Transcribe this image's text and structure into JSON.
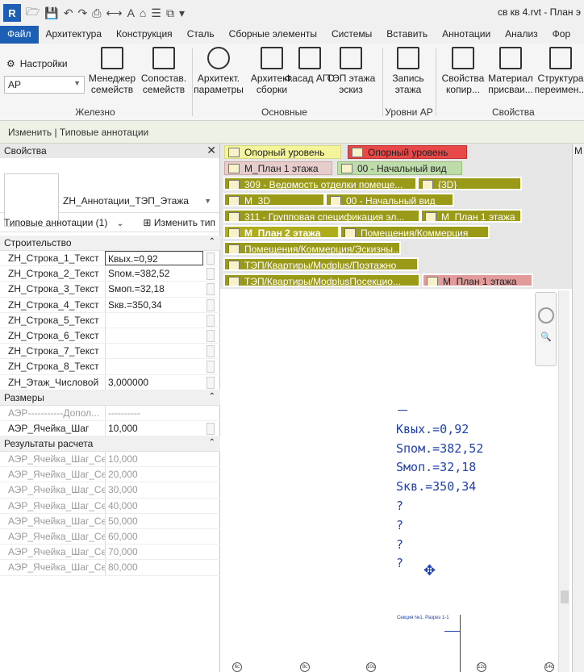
{
  "qat": {
    "logo": "R",
    "window_title": "св кв 4.rvt - План э"
  },
  "tabs": [
    "Файл",
    "Архитектура",
    "Конструкция",
    "Сталь",
    "Сборные элементы",
    "Системы",
    "Вставить",
    "Аннотации",
    "Анализ",
    "Фор"
  ],
  "ribbon": {
    "settings_label": "Настройки",
    "dropdown_value": "AP",
    "buttons": [
      {
        "label": "Менеджер семейств"
      },
      {
        "label": "Сопостав. семейств"
      },
      {
        "label": "Архитект. параметры"
      },
      {
        "label": "Архитект. сборки"
      },
      {
        "label": "Фасад АГО"
      },
      {
        "label": "ТЭП этажа эскиз"
      },
      {
        "label": "Запись этажа"
      },
      {
        "label": "Свойства копир..."
      },
      {
        "label": "Материал присваи..."
      },
      {
        "label": "Структура переимен..."
      }
    ],
    "groups": [
      "Железно",
      "Основные",
      "Уровни АР",
      "Свойства"
    ]
  },
  "context_bar": "Изменить | Типовые аннотации",
  "properties": {
    "header": "Свойства",
    "type_name": "ZH_Аннотации_ТЭП_Этажа",
    "filter": "Типовые аннотации (1)",
    "edit_type": "Изменить тип",
    "sections": [
      {
        "name": "Строительство",
        "rows": [
          {
            "k": "ZH_Строка_1_Текст",
            "v": "Квых.=0,92",
            "active": true
          },
          {
            "k": "ZH_Строка_2_Текст",
            "v": "Sпом.=382,52"
          },
          {
            "k": "ZH_Строка_3_Текст",
            "v": "Sмоп.=32,18"
          },
          {
            "k": "ZH_Строка_4_Текст",
            "v": "Sкв.=350,34"
          },
          {
            "k": "ZH_Строка_5_Текст",
            "v": ""
          },
          {
            "k": "ZH_Строка_6_Текст",
            "v": ""
          },
          {
            "k": "ZH_Строка_7_Текст",
            "v": ""
          },
          {
            "k": "ZH_Строка_8_Текст",
            "v": ""
          },
          {
            "k": "ZH_Этаж_Числовой",
            "v": "3,000000"
          }
        ]
      },
      {
        "name": "Размеры",
        "rows": [
          {
            "k": "АЭР-----------Допол...",
            "v": "----------",
            "dim": true
          },
          {
            "k": "АЭР_Ячейка_Шаг",
            "v": "10,000"
          }
        ]
      },
      {
        "name": "Результаты расчета",
        "rows": [
          {
            "k": "АЭР_Ячейка_Шаг_Се...",
            "v": "10,000",
            "dim": true
          },
          {
            "k": "АЭР_Ячейка_Шаг_Се...",
            "v": "20,000",
            "dim": true
          },
          {
            "k": "АЭР_Ячейка_Шаг_Се...",
            "v": "30,000",
            "dim": true
          },
          {
            "k": "АЭР_Ячейка_Шаг_Се...",
            "v": "40,000",
            "dim": true
          },
          {
            "k": "АЭР_Ячейка_Шаг_Се...",
            "v": "50,000",
            "dim": true
          },
          {
            "k": "АЭР_Ячейка_Шаг_Се...",
            "v": "60,000",
            "dim": true
          },
          {
            "k": "АЭР_Ячейка_Шаг_Се...",
            "v": "70,000",
            "dim": true
          },
          {
            "k": "АЭР_Ячейка_Шаг_Се...",
            "v": "80,000",
            "dim": true
          }
        ]
      }
    ]
  },
  "view_tabs": [
    {
      "label": "Опорный уровень",
      "style": "y"
    },
    {
      "label": "Опорный уровень",
      "style": "r"
    },
    {
      "label": "M_План 1 этажа",
      "style": "p"
    },
    {
      "label": "00 - Начальный вид",
      "style": "g"
    },
    {
      "label": "309 - Ведомость отделки помеще...",
      "style": "o"
    },
    {
      "label": "{3D}",
      "style": "o"
    },
    {
      "label": "M_3D",
      "style": "o"
    },
    {
      "label": "00 - Начальный вид",
      "style": "o"
    },
    {
      "label": "311 - Групповая спецификация эл...",
      "style": "o"
    },
    {
      "label": "M_План 1 этажа",
      "style": "o"
    },
    {
      "label": "M_План 2 этажа",
      "style": "o active"
    },
    {
      "label": "Помещения/Коммерция",
      "style": "o"
    },
    {
      "label": "Помещения/Коммерция/Эскизны...",
      "style": "o"
    },
    {
      "label": "ТЭП/Квартиры/Modplus/Поэтажно",
      "style": "o"
    },
    {
      "label": "ТЭП/Квартиры/ModplusПосекцио...",
      "style": "o"
    },
    {
      "label": "M_План 1 этажа",
      "style": "pr"
    }
  ],
  "annotation_lines": [
    "Kвых.=0,92",
    "Sпом.=382,52",
    "Sмоп.=32,18",
    "Sкв.=350,34",
    "?",
    "?",
    "?",
    "?"
  ],
  "section_label": "Секция №1. Разрез 1-1",
  "grid_bubbles": [
    "6c",
    "8c",
    "10c",
    "12c",
    "14c"
  ],
  "right_panel_label": "М"
}
